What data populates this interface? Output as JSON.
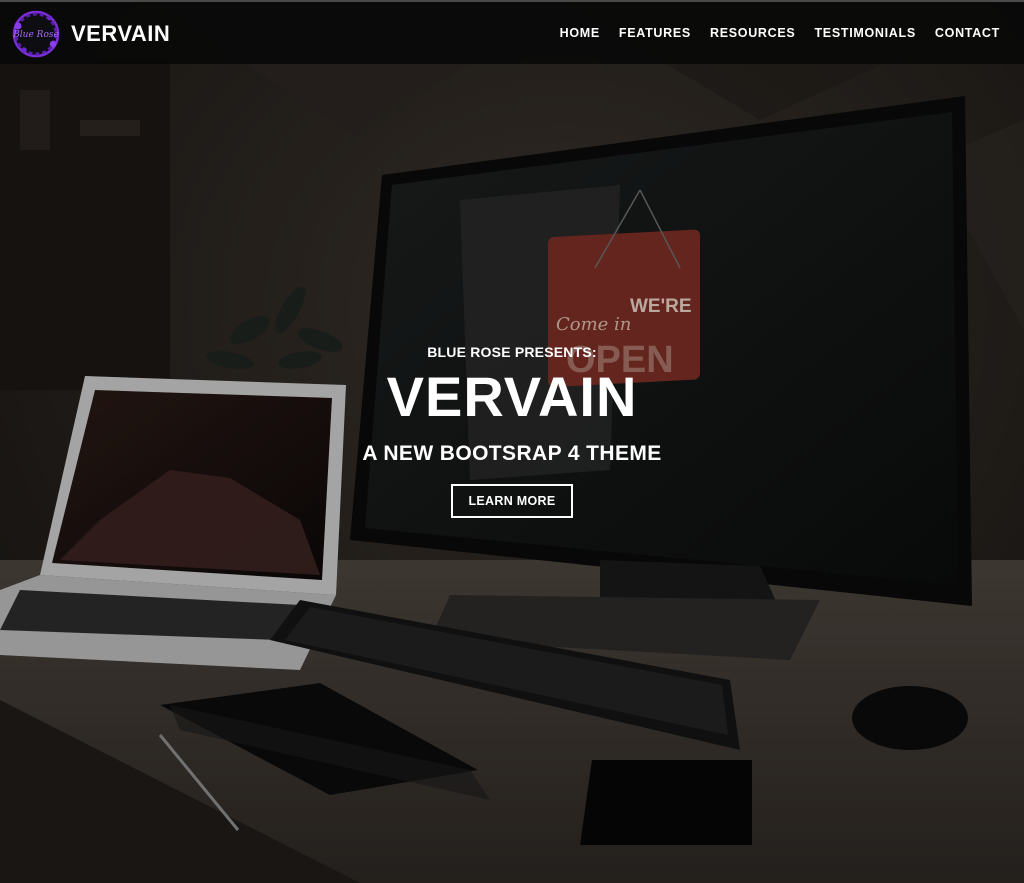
{
  "brand": {
    "logo_text": "Blue Rose",
    "name": "VERVAIN",
    "logo_color": "#7b2fd6"
  },
  "nav": {
    "items": [
      {
        "label": "HOME"
      },
      {
        "label": "FEATURES"
      },
      {
        "label": "RESOURCES"
      },
      {
        "label": "TESTIMONIALS"
      },
      {
        "label": "CONTACT"
      }
    ]
  },
  "hero": {
    "eyebrow": "BLUE ROSE PRESENTS:",
    "title": "VERVAIN",
    "subtitle": "A NEW BOOTSRAP 4 THEME",
    "cta": "LEARN MORE",
    "sign_text_top": "Come in",
    "sign_text_were": "WE'RE",
    "sign_text_open": "OPEN"
  }
}
